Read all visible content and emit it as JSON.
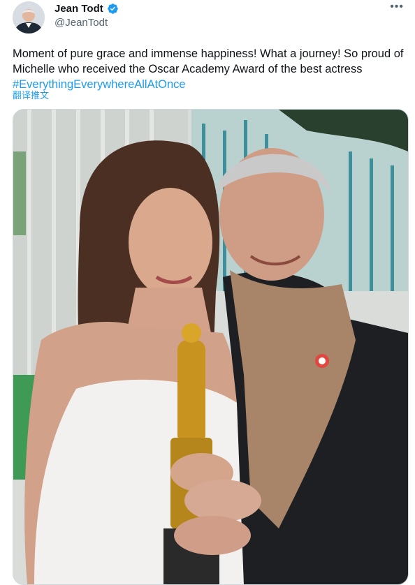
{
  "author": {
    "name": "Jean Todt",
    "handle": "@JeanTodt",
    "verified": true,
    "avatar_icon": "profile-avatar"
  },
  "menu_icon": "more-horizontal-icon",
  "tweet": {
    "text": "Moment of pure grace and immense happiness! What a journey! So proud of Michelle who received the Oscar Academy Award of the best actress ",
    "hashtag": "#EverythingEverywhereAllAtOnce",
    "translate_label": "翻译推文"
  },
  "colors": {
    "link": "#1d9bf0",
    "verified_badge": "#1d9bf0",
    "secondary_text": "#536471"
  }
}
